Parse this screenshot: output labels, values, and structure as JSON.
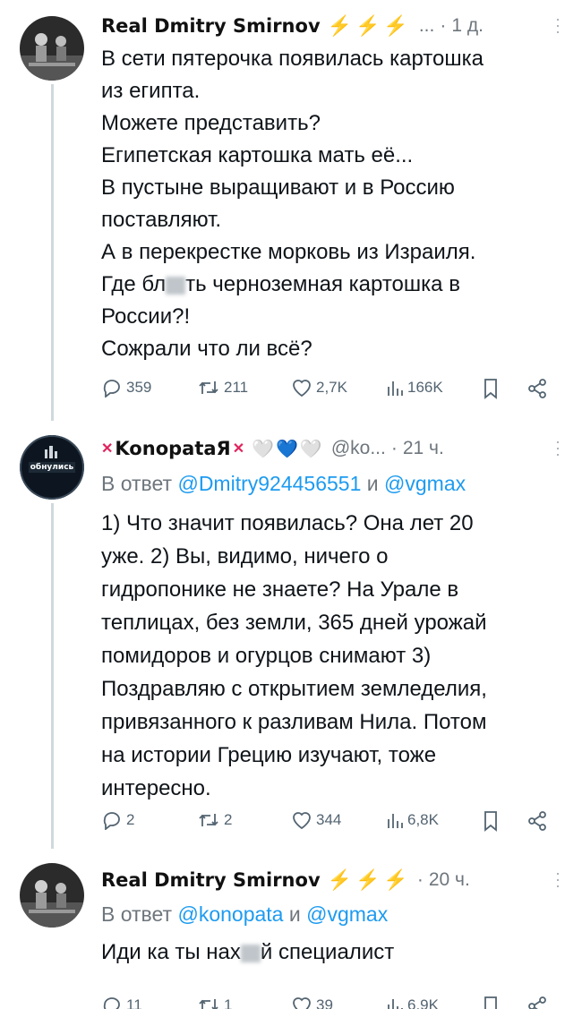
{
  "tweets": [
    {
      "name": "Real Dmitry Smirnov",
      "badges": "⚡⚡⚡",
      "handle": "...",
      "time": "1 д.",
      "lines": [
        "В сети пятерочка появилась картошка",
        "из египта.",
        "Можете представить?",
        "Египетская картошка мать её...",
        "В пустыне выращивают и в Россию",
        "поставляют.",
        "А в перекрестке морковь из Израиля.",
        "Где бл",
        "ть черноземная картошка в",
        "России?!",
        "Сожрали что ли всё?"
      ],
      "stats": {
        "replies": "359",
        "retweets": "211",
        "likes": "2,7K",
        "views": "166K"
      }
    },
    {
      "name": "KonopataЯ",
      "hearts": "🤍💙🤍",
      "handle": "@ko...",
      "time": "21 ч.",
      "avatar_text": "обнулись",
      "reply_prefix": "В ответ",
      "reply_m1": "@Dmitry924456551",
      "reply_and": "и",
      "reply_m2": "@vgmax",
      "lines": [
        "1) Что значит появилась? Она лет 20",
        "уже. 2) Вы, видимо, ничего о",
        "гидропонике не знаете? На Урале в",
        "теплицах, без земли, 365 дней урожай",
        "помидоров и огурцов снимают 3)",
        "Поздравляю с открытием земледелия,",
        "привязанного к разливам Нила. Потом",
        "на истории Грецию изучают, тоже",
        "интересно."
      ],
      "stats": {
        "replies": "2",
        "retweets": "2",
        "likes": "344",
        "views": "6,8K"
      }
    },
    {
      "name": "Real Dmitry Smirnov",
      "badges": "⚡⚡⚡",
      "time": "20 ч.",
      "reply_prefix": "В ответ",
      "reply_m1": "@konopata",
      "reply_and": "и",
      "reply_m2": "@vgmax",
      "line_a": "Иди ка ты нах",
      "line_b": "й специалист",
      "stats": {
        "replies": "11",
        "retweets": "1",
        "likes": "39",
        "views": "6,9K"
      }
    }
  ],
  "colors": {
    "link": "#1d9bf0",
    "muted": "#6e767d",
    "bolt": "#f5c400",
    "cross": "#e0245e"
  }
}
